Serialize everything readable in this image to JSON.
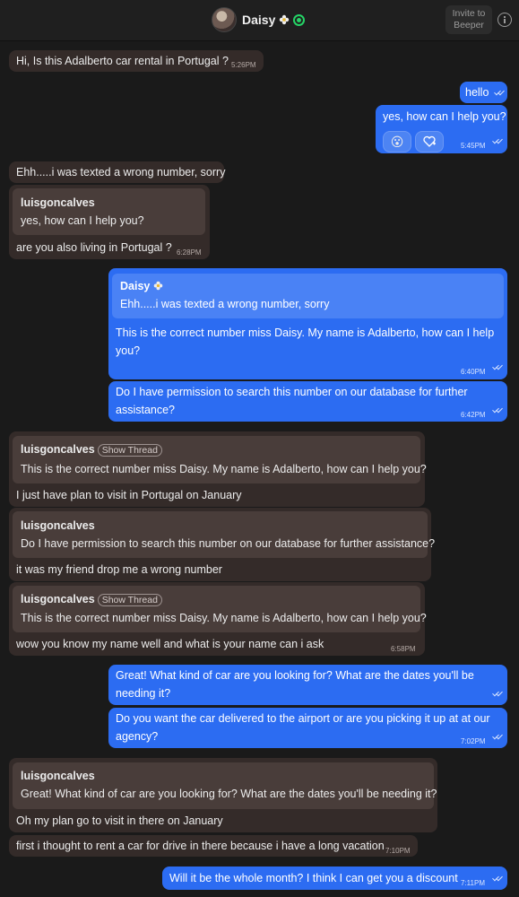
{
  "header": {
    "name": "Daisy",
    "invite_label": "Invite to Beeper"
  },
  "messages": {
    "m1": {
      "text": "Hi, Is this Adalberto car rental in Portugal  ?",
      "time": "5:26PM"
    },
    "m2": {
      "text": "hello"
    },
    "m3": {
      "text": "yes, how can I help you?",
      "time": "5:45PM",
      "reaction1": "😮"
    },
    "m4": {
      "text": "Ehh.....i was texted a wrong number, sorry"
    },
    "m5": {
      "quote_author": "luisgoncalves",
      "quote_text": "yes, how can I help you?",
      "text": "are you also living in Portugal  ?",
      "time": "6:28PM"
    },
    "m6": {
      "quote_author": "Daisy",
      "quote_text": "Ehh.....i was texted a wrong number, sorry",
      "text_line1": "This is the correct number miss Daisy. My name is Adalberto, how can I help",
      "text_line2": "you?",
      "time": "6:40PM"
    },
    "m7": {
      "text_line1": "Do I have permission to search this number on our database for further",
      "text_line2": "assistance?",
      "time": "6:42PM"
    },
    "m8": {
      "quote_author": "luisgoncalves",
      "show_thread": "Show Thread",
      "quote_text": "This is the correct number miss Daisy. My name is Adalberto, how can I help you?",
      "text": "I just have plan to visit in Portugal on January"
    },
    "m9": {
      "quote_author": "luisgoncalves",
      "quote_text": "Do I have permission to search this number on our database for further assistance?",
      "text": "it was my friend drop me a wrong number"
    },
    "m10": {
      "quote_author": "luisgoncalves",
      "show_thread": "Show Thread",
      "quote_text": "This is the correct number miss Daisy. My name is Adalberto, how can I help you?",
      "text": "wow you know my name well and what is your name can i ask",
      "time": "6:58PM"
    },
    "m11": {
      "text_line1": "Great! What kind of car are you looking for? What are the dates you'll be",
      "text_line2": "needing it?"
    },
    "m12": {
      "text_line1": "Do you want the car delivered to the airport or are you picking it up at at our",
      "text_line2": "agency?",
      "time": "7:02PM"
    },
    "m13": {
      "quote_author": "luisgoncalves",
      "quote_text": "Great! What kind of car are you looking for? What are the dates you'll be needing it?",
      "text": "Oh my plan go to visit in there on January"
    },
    "m14": {
      "text": "first i thought to rent a car for drive in there because i have a long vacation",
      "time": "7:10PM"
    },
    "m15": {
      "text": "Will it be the whole month? I think I can get you a discount",
      "time": "7:11PM"
    }
  },
  "colors": {
    "incoming": "#342b29",
    "outgoing": "#2c6cf2",
    "background": "#1a1a1a"
  },
  "icons": {
    "avatar": "avatar",
    "status": "whatsapp-icon",
    "info": "info-icon",
    "flower": "flower-icon",
    "read": "double-check-icon"
  }
}
